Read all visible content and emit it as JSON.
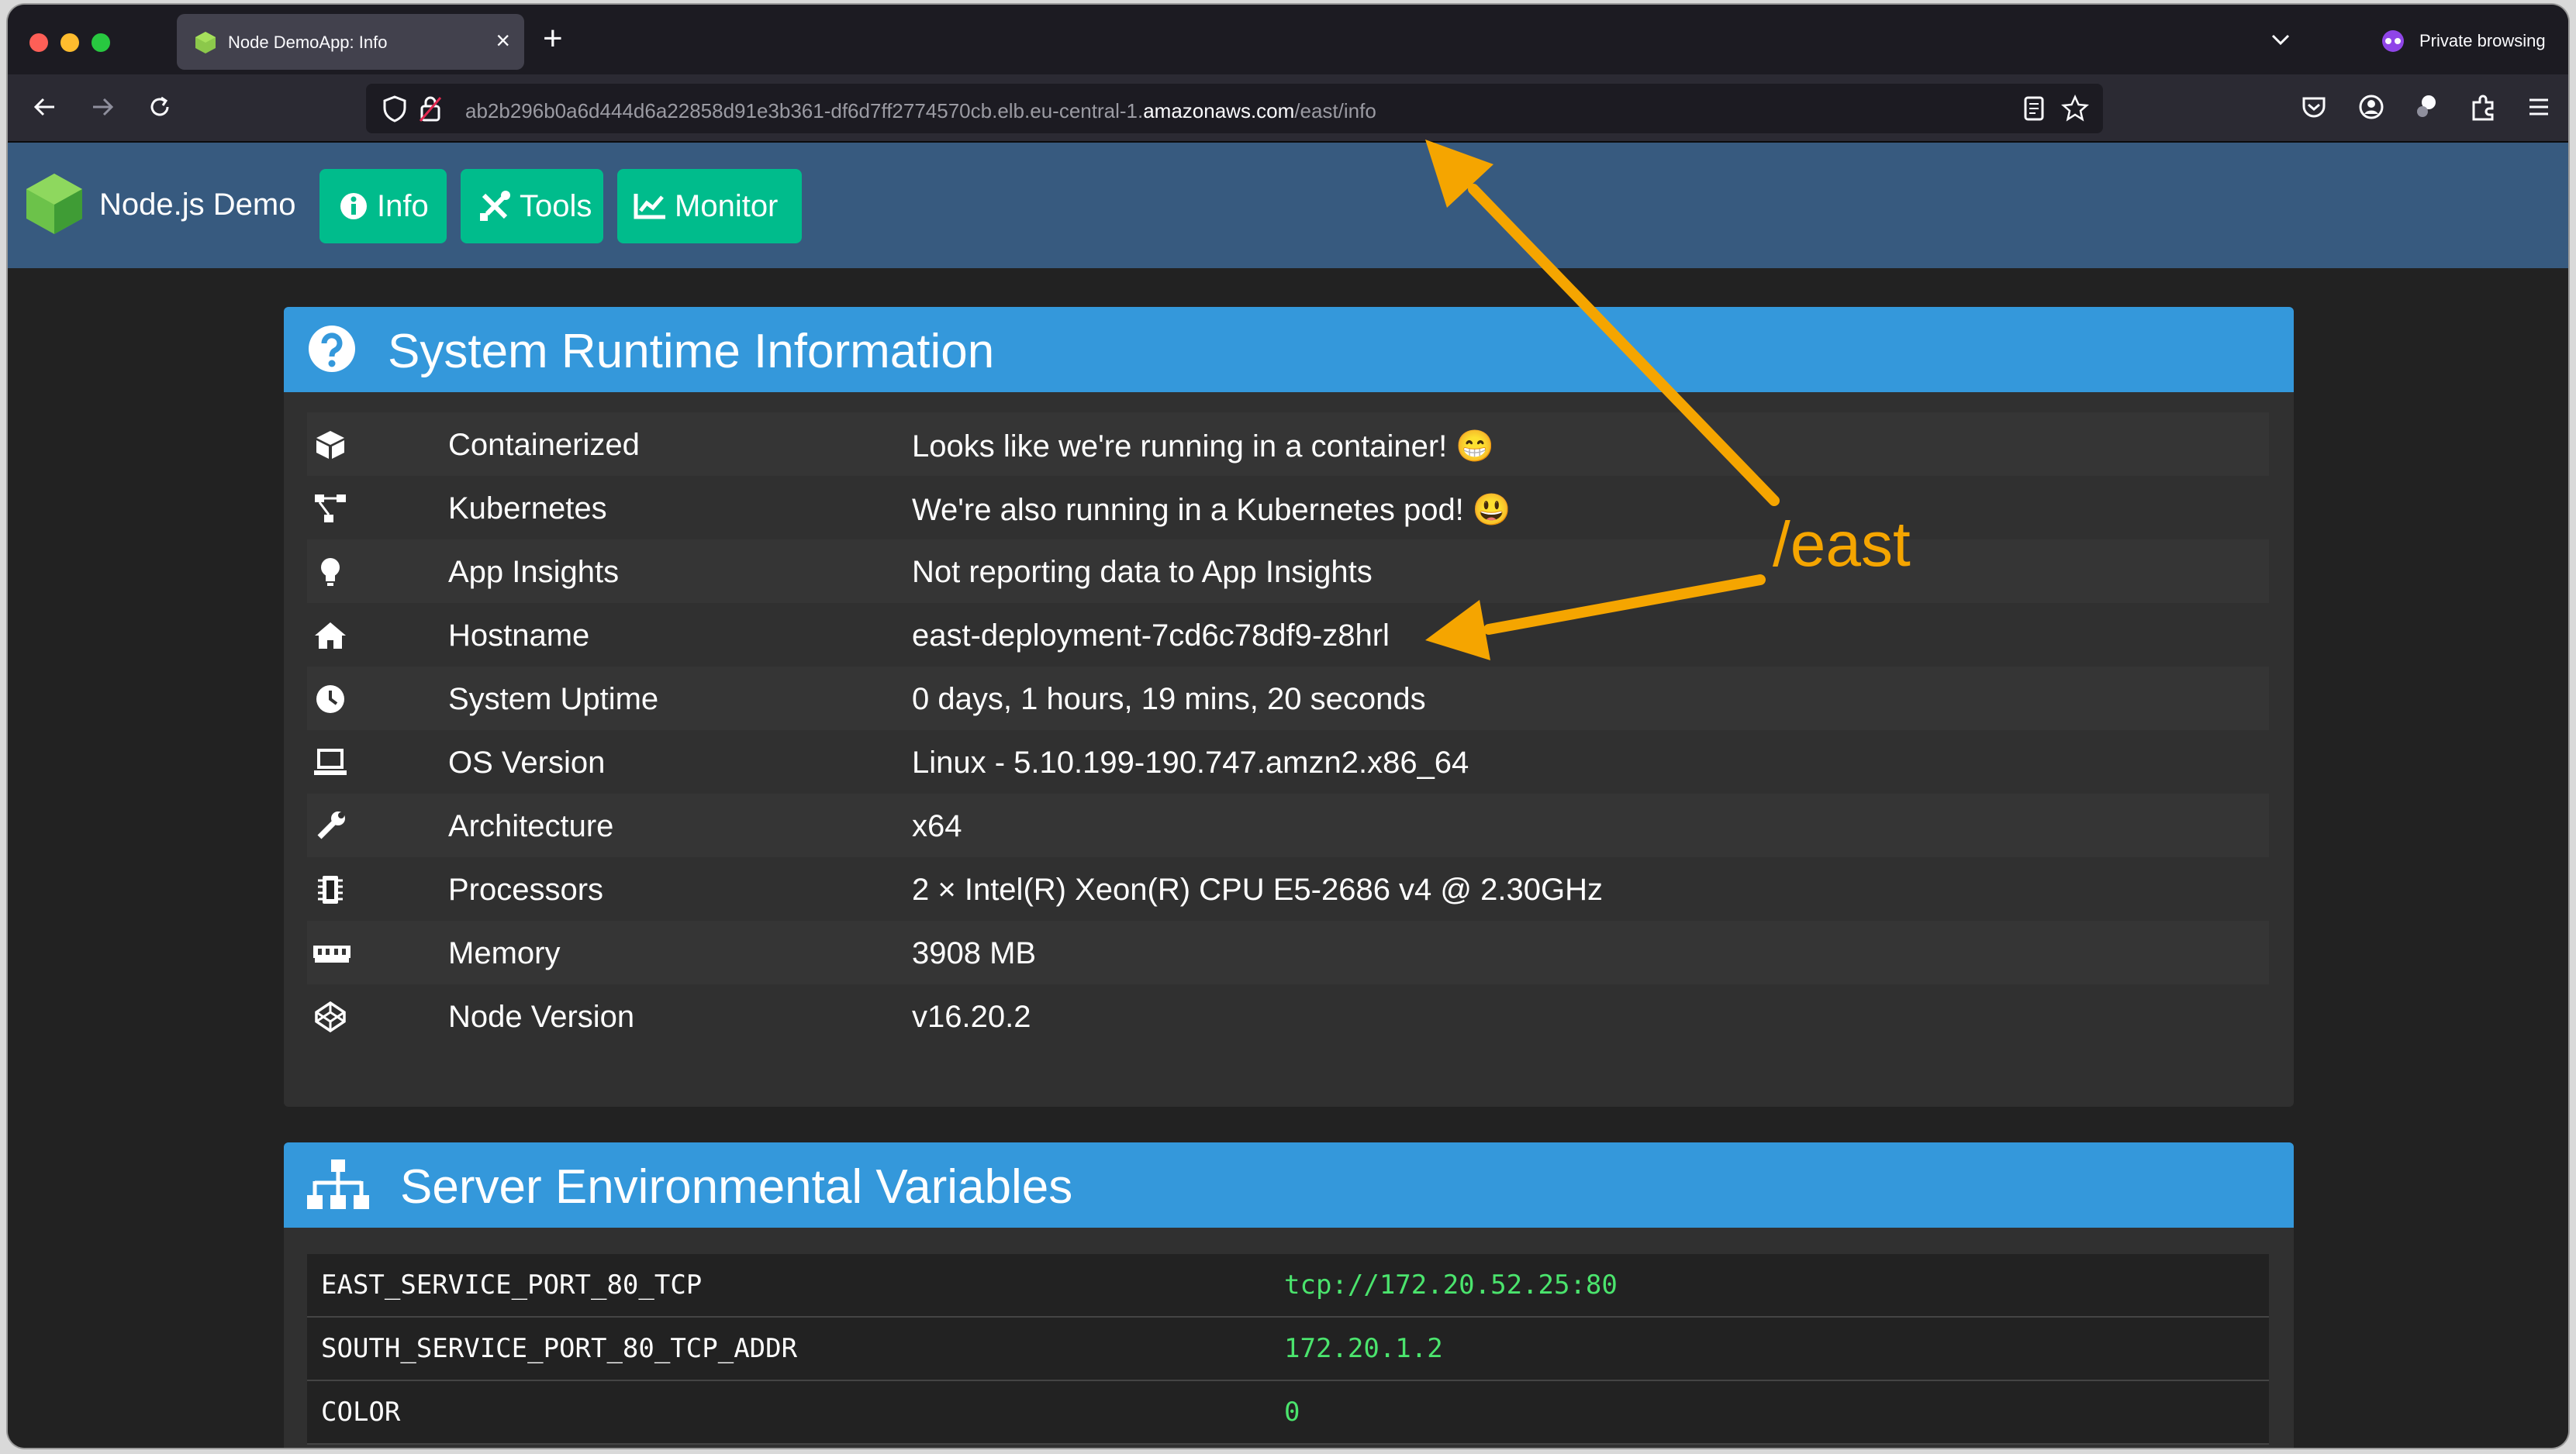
{
  "browser": {
    "tab_title": "Node DemoApp: Info",
    "tab_close": "×",
    "new_tab": "+",
    "private_label": "Private browsing",
    "url_prefix": "ab2b296b0a6d444d6a22858d91e3b361-df6d7ff2774570cb.elb.eu-central-1.",
    "url_domain": "amazonaws.com",
    "url_path": "/east/info"
  },
  "app": {
    "brand": "Node.js Demo",
    "nav": [
      {
        "label": "Info",
        "icon": "info-circle-icon"
      },
      {
        "label": "Tools",
        "icon": "tools-icon"
      },
      {
        "label": "Monitor",
        "icon": "chart-line-icon"
      }
    ]
  },
  "runtime": {
    "title": "System Runtime Information",
    "rows": [
      {
        "label": "Containerized",
        "value": "Looks like we're running in a container! 😁",
        "icon": "cube-icon"
      },
      {
        "label": "Kubernetes",
        "value": "We're also running in a Kubernetes pod! 😃",
        "icon": "network-nodes-icon"
      },
      {
        "label": "App Insights",
        "value": "Not reporting data to App Insights",
        "icon": "lightbulb-icon"
      },
      {
        "label": "Hostname",
        "value": "east-deployment-7cd6c78df9-z8hrl",
        "icon": "home-icon"
      },
      {
        "label": "System Uptime",
        "value": "0 days, 1 hours, 19 mins, 20 seconds",
        "icon": "clock-icon"
      },
      {
        "label": "OS Version",
        "value": "Linux - 5.10.199-190.747.amzn2.x86_64",
        "icon": "laptop-icon"
      },
      {
        "label": "Architecture",
        "value": "x64",
        "icon": "wrench-icon"
      },
      {
        "label": "Processors",
        "value": "2 × Intel(R) Xeon(R) CPU E5-2686 v4 @ 2.30GHz",
        "icon": "chip-icon"
      },
      {
        "label": "Memory",
        "value": "3908 MB",
        "icon": "memory-icon"
      },
      {
        "label": "Node Version",
        "value": "v16.20.2",
        "icon": "codepen-icon"
      }
    ]
  },
  "env": {
    "title": "Server Environmental Variables",
    "rows": [
      {
        "key": "EAST_SERVICE_PORT_80_TCP",
        "value": "tcp://172.20.52.25:80"
      },
      {
        "key": "SOUTH_SERVICE_PORT_80_TCP_ADDR",
        "value": "172.20.1.2"
      },
      {
        "key": "COLOR",
        "value": "0"
      }
    ]
  },
  "annotation": {
    "label": "/east",
    "color": "#f5a500"
  },
  "colors": {
    "navbar": "#375a7f",
    "button": "#00bc8c",
    "card_header": "#3498db",
    "env_value": "#4be46d"
  }
}
